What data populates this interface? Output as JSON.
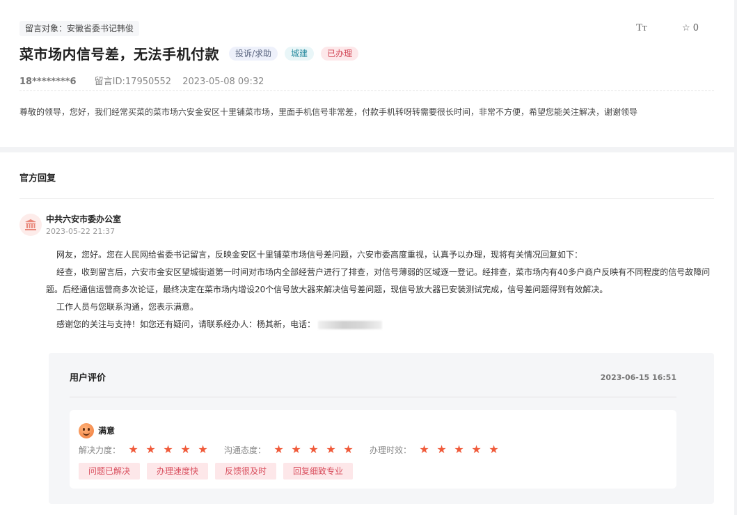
{
  "message": {
    "target": "留言对象：安徽省委书记韩俊",
    "font_toggle": "Tт",
    "favorite": {
      "icon": "star-outline-icon",
      "count": "0"
    },
    "title": "菜市场内信号差，无法手机付款",
    "tags": {
      "type": "投诉/求助",
      "domain": "城建",
      "status": "已办理"
    },
    "user": "18********6",
    "message_id": "留言ID:17950552",
    "datetime": "2023-05-08 09:32",
    "body": "尊敬的领导，您好，我们经常买菜的菜市场六安金安区十里铺菜市场，里面手机信号非常差，付款手机转呀转需要很长时间，非常不方便，希望您能关注解决，谢谢领导"
  },
  "reply": {
    "section_title": "官方回复",
    "org_icon": "government-building-icon",
    "org_name": "中共六安市委办公室",
    "org_time": "2023-05-22 21:37",
    "paragraphs": [
      "网友，您好。您在人民网给省委书记留言，反映金安区十里铺菜市场信号差问题，六安市委高度重视，认真予以办理，现将有关情况回复如下：",
      "经查，收到留言后，六安市金安区望城街道第一时间对市场内全部经营户进行了排查，对信号薄弱的区域逐一登记。经排查，菜市场内有40多户商户反映有不同程度的信号故障问题。后经通信运营商多次论证，最终决定在菜市场内增设20个信号放大器来解决信号差问题，现信号放大器已安装测试完成，信号差问题得到有效解决。",
      "工作人员与您联系沟通，您表示满意。",
      "感谢您的关注与支持！如您还有疑问，请联系经办人：杨其新，电话："
    ]
  },
  "evaluation": {
    "title": "用户评价",
    "time": "2023-06-15 16:51",
    "satisfaction_icon": "smile-face-icon",
    "satisfaction": "满意",
    "ratings": [
      {
        "label": "解决力度：",
        "stars": 5
      },
      {
        "label": "沟通态度：",
        "stars": 5
      },
      {
        "label": "办理时效：",
        "stars": 5
      }
    ],
    "chips": [
      "问题已解决",
      "办理速度快",
      "反馈很及时",
      "回复细致专业"
    ],
    "colors": {
      "star": "#f05a3a",
      "chip_bg": "#fde7e9",
      "chip_text": "#d9505f"
    }
  }
}
